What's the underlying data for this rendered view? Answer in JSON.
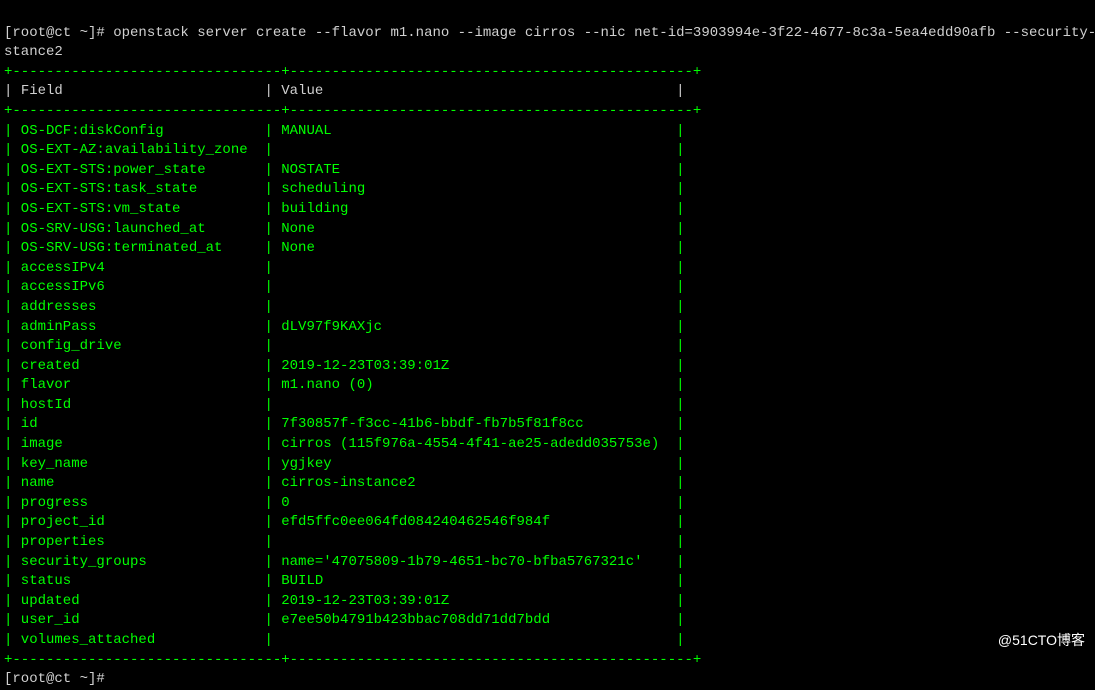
{
  "prompt_prefix": "[root@ct ~]# ",
  "command_line1": "openstack server create --flavor m1.nano --image cirros --nic net-id=3903994e-3f22-4677-8c3a-5ea4edd90afb --security-group d",
  "command_line2": "stance2",
  "header_field": "Field",
  "header_value": "Value",
  "separator": "+--------------------------------+------------------------------------------------+",
  "rows": [
    {
      "field": "OS-DCF:diskConfig",
      "value": "MANUAL"
    },
    {
      "field": "OS-EXT-AZ:availability_zone",
      "value": ""
    },
    {
      "field": "OS-EXT-STS:power_state",
      "value": "NOSTATE"
    },
    {
      "field": "OS-EXT-STS:task_state",
      "value": "scheduling"
    },
    {
      "field": "OS-EXT-STS:vm_state",
      "value": "building"
    },
    {
      "field": "OS-SRV-USG:launched_at",
      "value": "None"
    },
    {
      "field": "OS-SRV-USG:terminated_at",
      "value": "None"
    },
    {
      "field": "accessIPv4",
      "value": ""
    },
    {
      "field": "accessIPv6",
      "value": ""
    },
    {
      "field": "addresses",
      "value": ""
    },
    {
      "field": "adminPass",
      "value": "dLV97f9KAXjc"
    },
    {
      "field": "config_drive",
      "value": ""
    },
    {
      "field": "created",
      "value": "2019-12-23T03:39:01Z"
    },
    {
      "field": "flavor",
      "value": "m1.nano (0)"
    },
    {
      "field": "hostId",
      "value": ""
    },
    {
      "field": "id",
      "value": "7f30857f-f3cc-41b6-bbdf-fb7b5f81f8cc"
    },
    {
      "field": "image",
      "value": "cirros (115f976a-4554-4f41-ae25-adedd035753e)"
    },
    {
      "field": "key_name",
      "value": "ygjkey"
    },
    {
      "field": "name",
      "value": "cirros-instance2"
    },
    {
      "field": "progress",
      "value": "0"
    },
    {
      "field": "project_id",
      "value": "efd5ffc0ee064fd084240462546f984f"
    },
    {
      "field": "properties",
      "value": ""
    },
    {
      "field": "security_groups",
      "value": "name='47075809-1b79-4651-bc70-bfba5767321c'"
    },
    {
      "field": "status",
      "value": "BUILD"
    },
    {
      "field": "updated",
      "value": "2019-12-23T03:39:01Z"
    },
    {
      "field": "user_id",
      "value": "e7ee50b4791b423bbac708dd71dd7bdd"
    },
    {
      "field": "volumes_attached",
      "value": ""
    }
  ],
  "prompt_after": "[root@ct ~]#",
  "watermark": "@51CTO博客"
}
